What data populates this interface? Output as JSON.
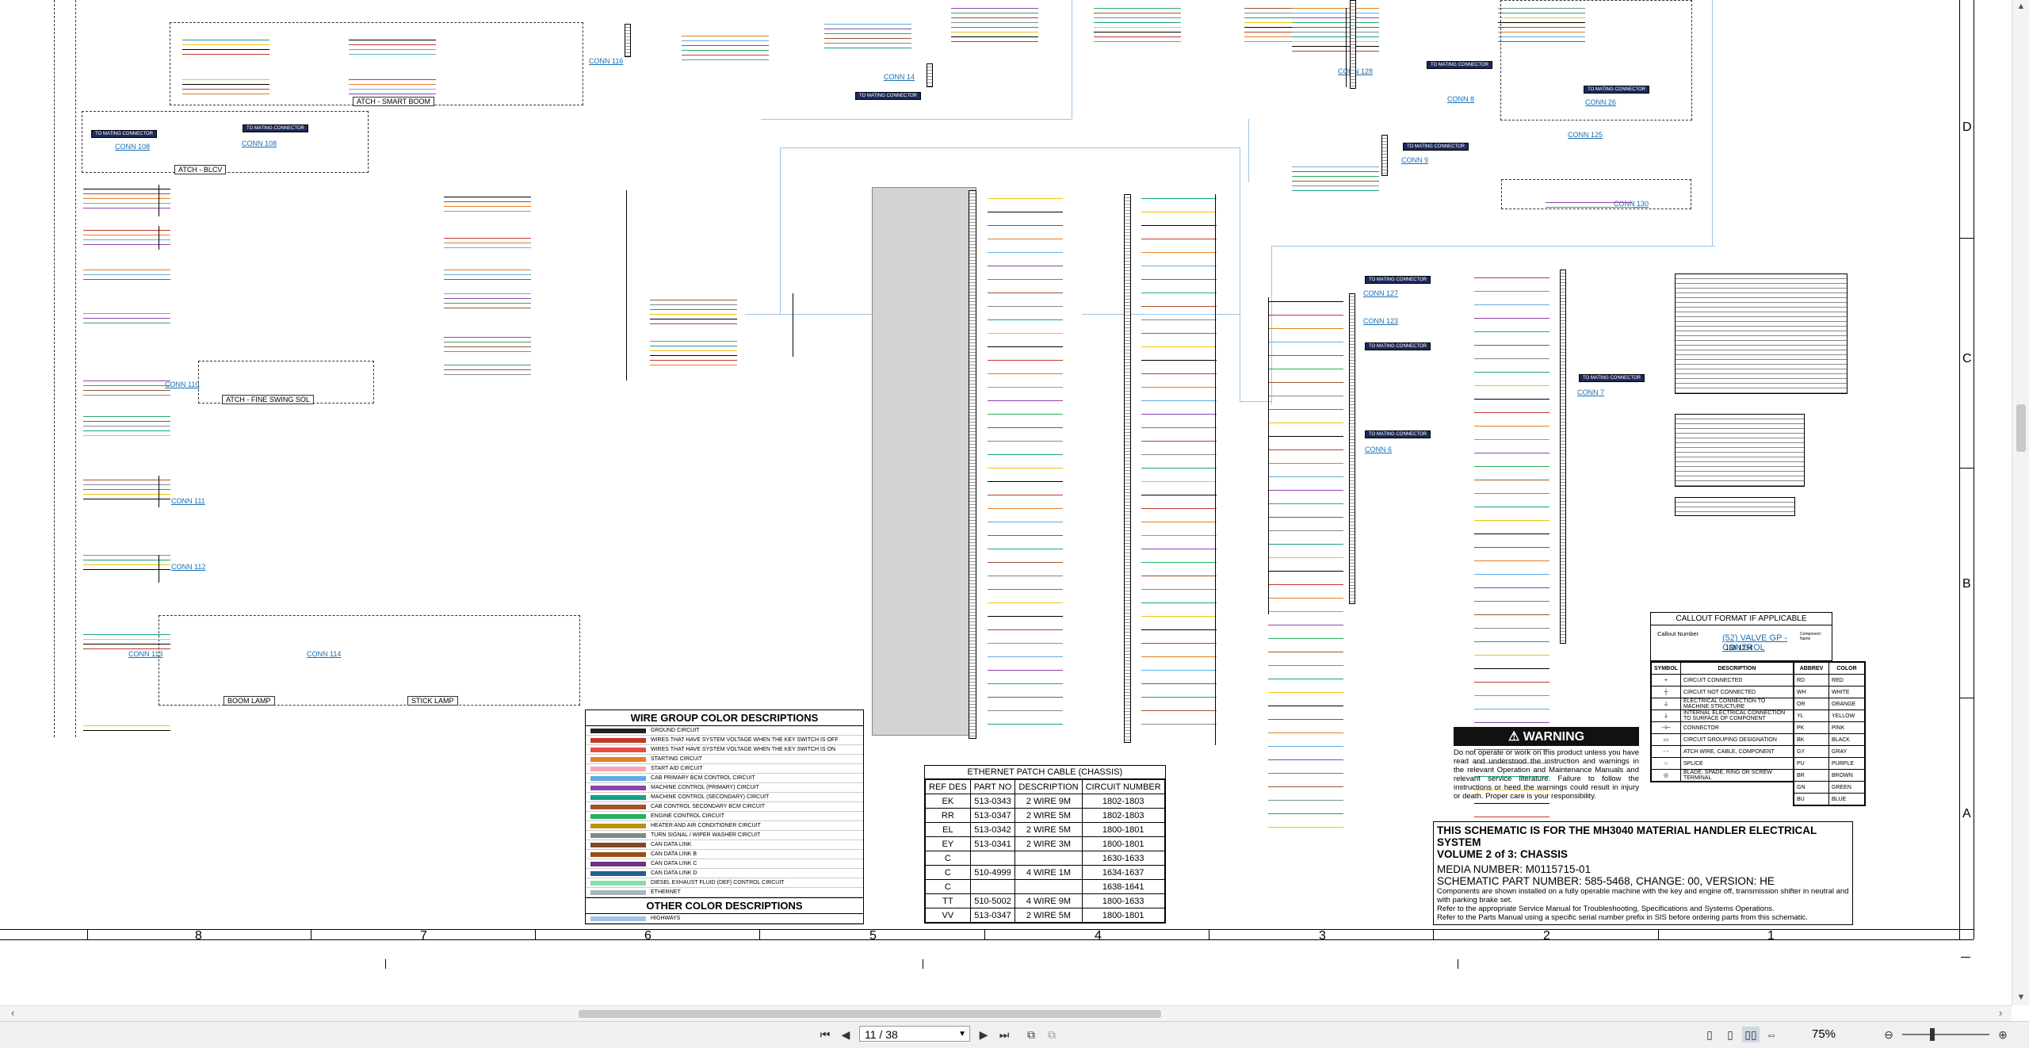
{
  "document": {
    "page_current": "11 / 38",
    "zoom": "75%",
    "zone_numbers": [
      "8",
      "7",
      "6",
      "5",
      "4",
      "3",
      "2",
      "1"
    ],
    "zone_letters": [
      "D",
      "C",
      "B",
      "A"
    ]
  },
  "connectors": {
    "conn_116": "CONN 116",
    "conn_108": "CONN 108",
    "conn_14": "CONN 14",
    "conn_110": "CONN 110",
    "conn_111": "CONN 111",
    "conn_112": "CONN 112",
    "conn_113": "CONN 113",
    "conn_114": "CONN 114",
    "conn_128": "CONN 128",
    "conn_8": "CONN 8",
    "conn_26": "CONN 26",
    "conn_125": "CONN 125",
    "conn_9": "CONN 9",
    "conn_130": "CONN 130",
    "conn_127": "CONN 127",
    "conn_123": "CONN 123",
    "conn_6": "CONN 6",
    "conn_7": "CONN 7"
  },
  "labels": {
    "atch_smart_boom": "ATCH - SMART BOOM",
    "atch_blcv": "ATCH - BLCV",
    "atch_fine_swing": "ATCH - FINE SWING SOL",
    "boom_lamp": "BOOM LAMP",
    "stick_lamp": "STICK LAMP",
    "to_mating": "TO MATING CONNECTOR"
  },
  "wire_group": {
    "title": "WIRE GROUP COLOR DESCRIPTIONS",
    "rows": [
      {
        "color": "#222222",
        "label": "GROUND CIRCUIT"
      },
      {
        "color": "#c0392b",
        "label": "WIRES THAT HAVE SYSTEM VOLTAGE WHEN THE KEY SWITCH IS OFF"
      },
      {
        "color": "#e74c3c",
        "label": "WIRES THAT HAVE SYSTEM VOLTAGE WHEN THE KEY SWITCH IS ON"
      },
      {
        "color": "#e67e22",
        "label": "STARTING CIRCUIT"
      },
      {
        "color": "#f4a6b8",
        "label": "START AID CIRCUIT"
      },
      {
        "color": "#5dade2",
        "label": "CAB PRIMARY BCM CONTROL CIRCUIT"
      },
      {
        "color": "#8e44ad",
        "label": "MACHINE CONTROL (PRIMARY) CIRCUIT"
      },
      {
        "color": "#16a085",
        "label": "MACHINE CONTROL (SECONDARY) CIRCUIT"
      },
      {
        "color": "#a0522d",
        "label": "CAB CONTROL SECONDARY BCM CIRCUIT"
      },
      {
        "color": "#27ae60",
        "label": "ENGINE CONTROL CIRCUIT"
      },
      {
        "color": "#b7950b",
        "label": "HEATER AND AIR CONDITIONER CIRCUIT"
      },
      {
        "color": "#7f8c8d",
        "label": "TURN SIGNAL / WIPER WASHER CIRCUIT"
      },
      {
        "color": "#7b4a2a",
        "label": "CAN DATA LINK"
      },
      {
        "color": "#935116",
        "label": "CAN DATA LINK B"
      },
      {
        "color": "#6c3483",
        "label": "CAN DATA LINK C"
      },
      {
        "color": "#1f618d",
        "label": "CAN DATA LINK D"
      },
      {
        "color": "#82e0aa",
        "label": "DIESEL EXHAUST FLUID (DEF) CONTROL CIRCUIT"
      },
      {
        "color": "#aab7b8",
        "label": "ETHERNET"
      }
    ],
    "other_title": "OTHER COLOR DESCRIPTIONS",
    "other_rows": [
      {
        "color": "#9ec5e8",
        "label": "HIGHWAYS"
      }
    ]
  },
  "ethernet": {
    "title": "ETHERNET PATCH CABLE (CHASSIS)",
    "headers": [
      "REF DES",
      "PART NO",
      "DESCRIPTION",
      "CIRCUIT NUMBER"
    ],
    "rows": [
      [
        "EK",
        "513-0343",
        "2 WIRE 9M",
        "1802-1803"
      ],
      [
        "RR",
        "513-0347",
        "2 WIRE 5M",
        "1802-1803"
      ],
      [
        "EL",
        "513-0342",
        "2 WIRE 5M",
        "1800-1801"
      ],
      [
        "EY",
        "513-0341",
        "2 WIRE 3M",
        "1800-1801"
      ],
      [
        "C",
        "",
        "",
        "1630-1633"
      ],
      [
        "C",
        "510-4999",
        "4 WIRE 1M",
        "1634-1637"
      ],
      [
        "C",
        "",
        "",
        "1638-1641"
      ],
      [
        "TT",
        "510-5002",
        "4 WIRE 9M",
        "1800-1633"
      ],
      [
        "VV",
        "513-0347",
        "2 WIRE 5M",
        "1800-1801"
      ]
    ]
  },
  "warning": {
    "heading": "WARNING",
    "text": "Do not operate or work on this product unless you have read and understood the instruction and warnings in the relevant Operation and Maintenance Manuals and relevant service literature. Failure to follow the instructions or heed the warnings could result in injury or death. Proper care is your responsibility."
  },
  "title_block": {
    "line1": "THIS SCHEMATIC IS FOR THE MH3040 MATERIAL HANDLER ELECTRICAL SYSTEM",
    "line2": "VOLUME 2 of 3: CHASSIS",
    "line3": "MEDIA NUMBER: M0115715-01",
    "line4": "SCHEMATIC PART NUMBER: 585-5468, CHANGE: 00, VERSION: HE",
    "note1": "Components are shown installed on a fully operable machine with the key and engine off, transmission shifter in neutral and with parking brake set.",
    "note2": "Refer to the appropriate Service Manual for Troubleshooting, Specifications and Systems Operations.",
    "note3": "Refer to the Parts Manual using a specific serial number prefix in SIS before ordering parts from this schematic."
  },
  "callout": {
    "title": "CALLOUT FORMAT IF APPLICABLE",
    "callout_number": "Callout Number",
    "sample": "(52) VALVE GP - CONTROL",
    "part": "138-1234",
    "component_name": "Component Name"
  },
  "symbols": {
    "head_symbol": "SYMBOL",
    "head_desc": "DESCRIPTION",
    "rows": [
      {
        "sym": "+",
        "desc": "CIRCUIT CONNECTED"
      },
      {
        "sym": "┼",
        "desc": "CIRCUIT NOT CONNECTED"
      },
      {
        "sym": "⏚",
        "desc": "ELECTRICAL CONNECTION TO MACHINE STRUCTURE"
      },
      {
        "sym": "⏚",
        "desc": "INTERNAL ELECTRICAL CONNECTION TO SURFACE OF COMPONENT"
      },
      {
        "sym": "⊣⊢",
        "desc": "CONNECTOR"
      },
      {
        "sym": "▭",
        "desc": "CIRCUIT GROUPING DESIGNATION"
      },
      {
        "sym": "- -",
        "desc": "ATCH WIRE, CABLE, COMPONENT"
      },
      {
        "sym": "○",
        "desc": "SPLICE"
      },
      {
        "sym": "◎",
        "desc": "BLADE, SPADE, RING OR SCREW TERMINAL"
      }
    ]
  },
  "abbrev": {
    "head_abbr": "ABBREV",
    "head_color": "COLOR",
    "rows": [
      [
        "RD",
        "RED"
      ],
      [
        "WH",
        "WHITE"
      ],
      [
        "OR",
        "ORANGE"
      ],
      [
        "YL",
        "YELLOW"
      ],
      [
        "PK",
        "PINK"
      ],
      [
        "BK",
        "BLACK"
      ],
      [
        "GY",
        "GRAY"
      ],
      [
        "PU",
        "PURPLE"
      ],
      [
        "BR",
        "BROWN"
      ],
      [
        "GN",
        "GREEN"
      ],
      [
        "BU",
        "BLUE"
      ]
    ]
  },
  "colors": {
    "tag_bg": "#1c2a5a",
    "link": "#1a6fb3",
    "highway": "#9ec5e8"
  }
}
